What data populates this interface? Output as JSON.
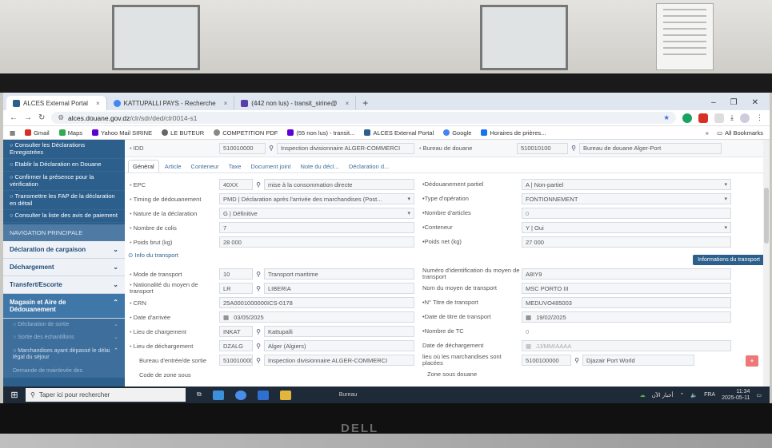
{
  "browser": {
    "tabs": [
      {
        "label": "ALCES External Portal",
        "active": true
      },
      {
        "label": "KATTUPALLI PAYS - Recherche",
        "active": false
      },
      {
        "label": "(442 non lus) - transit_sirine@",
        "active": false
      }
    ],
    "url_host": "alces.douane.gov.dz",
    "url_path": "/clr/sdr/ded/clr0014-s1",
    "bookmarks": [
      "Gmail",
      "Maps",
      "Yahoo Mail SIRINE",
      "LE BUTEUR",
      "COMPETITION PDF",
      "(55 non lus) - transit...",
      "ALCES External Portal",
      "Google",
      "Horaires de prières..."
    ],
    "all_bookmarks": "All Bookmarks"
  },
  "sidebar": {
    "links": [
      "Consulter les Déclarations Enregistrées",
      "Etablir la Déclaration en Douane",
      "Confirmer la présence pour la vérification",
      "Transmettre les FAP de la déclaration en détail",
      "Consulter la liste des avis de paiement"
    ],
    "nav_header": "NAVIGATION PRINCIPALE",
    "accordions": [
      "Déclaration de cargaison",
      "Déchargement",
      "Transfert/Escorte"
    ],
    "open_accordion": "Magasin et Aire de Dédouanement",
    "subitems": [
      "Déclaration de sortie",
      "Sortie des échantillons",
      "Marchandises ayant dépassé le délai légal du séjour",
      "Demande de mainlevée des"
    ]
  },
  "header_fields": {
    "idd_label": "IDD",
    "idd_code": "510010000",
    "idd_text": "Inspection divisionnaire ALGER-COMMERCI",
    "bureau_label": "Bureau de douane",
    "bureau_code": "510010100",
    "bureau_text": "Bureau de douane Alger-Port"
  },
  "form_tabs": [
    "Général",
    "Article",
    "Conteneur",
    "Taxe",
    "Document joint",
    "Note du décl...",
    "Déclaration d..."
  ],
  "left_rows": [
    {
      "label": "EPC",
      "value": "40XX",
      "extra": "mise à la consommation directe"
    },
    {
      "label": "Timing de dédouanement",
      "value": "PMD | Déclaration après l'arrivée des marchandises (Post..."
    },
    {
      "label": "Nature de la déclaration",
      "value": "G | Définitive"
    },
    {
      "label": "Nombre de colis",
      "value": "7"
    },
    {
      "label": "Poids brut (kg)",
      "value": "28 000"
    }
  ],
  "right_rows": [
    {
      "label": "Dédouanement partiel",
      "value": "A | Non-partiel"
    },
    {
      "label": "Type d'opération",
      "value": "FONTIONNEMENT"
    },
    {
      "label": "Nombre d'articles",
      "value": "0"
    },
    {
      "label": "Conteneur",
      "value": "Y | Oui"
    },
    {
      "label": "Poids net (kg)",
      "value": "27 000"
    }
  ],
  "transport": {
    "section_label": "Info du transport",
    "info_button": "Informations du transport",
    "left": [
      {
        "label": "Mode de transport",
        "value": "10",
        "extra": "Transport maritime"
      },
      {
        "label": "Nationalité du moyen de transport",
        "value": "LR",
        "extra": "LIBERIA"
      },
      {
        "label": "CRN",
        "value": "25A0001000000ICS-0178"
      },
      {
        "label": "Date d'arrivée",
        "value": "03/05/2025"
      },
      {
        "label": "Lieu de chargement",
        "value": "INKAT",
        "extra": "Kattupalli"
      },
      {
        "label": "Lieu de déchargement",
        "value": "DZALG",
        "extra": "Alger (Algiers)"
      },
      {
        "label": "Bureau d'entrée/de sortie",
        "value": "510010000",
        "extra": "Inspection divisionnaire ALGER-COMMERCI"
      },
      {
        "label": "Code de zone sous",
        "value": ""
      }
    ],
    "right": [
      {
        "label": "Numéro d'identification du moyen de transport",
        "value": "A8IY9"
      },
      {
        "label": "Nom du moyen de transport",
        "value": "MSC PORTO III"
      },
      {
        "label": "N° Titre de transport",
        "value": "MEDUVO485003"
      },
      {
        "label": "Date de titre de transport",
        "value": "19/02/2025"
      },
      {
        "label": "Nombre de TC",
        "value": "0"
      },
      {
        "label": "Date de déchargement",
        "value": "JJ/MM/AAAA"
      },
      {
        "label": "lieu où les marchandises sont placées",
        "value": "5100100000",
        "extra": "Djazair Port World"
      },
      {
        "label": "Zone sous douane",
        "value": ""
      }
    ]
  },
  "taskbar": {
    "search_placeholder": "Taper ici pour rechercher",
    "center_label": "Bureau",
    "news": "أخبار الآن",
    "lang": "FRA",
    "time": "11:34",
    "date": "2025-05-11"
  },
  "monitor_brand": "DELL"
}
